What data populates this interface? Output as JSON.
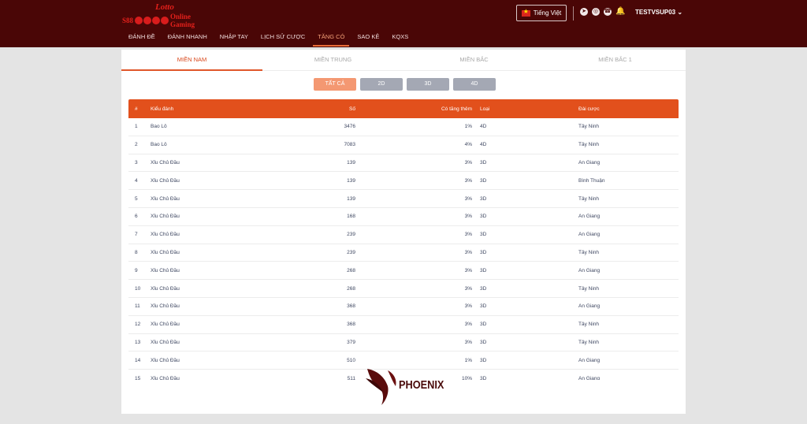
{
  "header": {
    "logo": {
      "top": "Lotto",
      "left": "S88",
      "right": "Online Gaming"
    },
    "language": "Tiếng Việt",
    "icons": [
      "telegram-icon",
      "messenger-icon",
      "whatsapp-icon",
      "bell-icon"
    ],
    "username": "TESTVSUP03"
  },
  "nav": [
    "ĐÁNH ĐỀ",
    "ĐÁNH NHANH",
    "NHẬP TAY",
    "LỊCH SỬ CƯỢC",
    "TĂNG CÓ",
    "SAO KÊ",
    "KQXS"
  ],
  "nav_active": "TĂNG CÓ",
  "region_tabs": [
    "MIỀN NAM",
    "MIỀN TRUNG",
    "MIỀN BẮC",
    "MIỀN BẮC 1"
  ],
  "filters": [
    "TẤT CẢ",
    "2D",
    "3D",
    "4D"
  ],
  "table": {
    "columns": [
      "#",
      "Kiểu đánh",
      "Số",
      "Có tăng thêm",
      "Loại",
      "Đài cược"
    ],
    "rows": [
      [
        "1",
        "Bao Lô",
        "3476",
        "1%",
        "4D",
        "Tây Ninh"
      ],
      [
        "2",
        "Bao Lô",
        "7083",
        "4%",
        "4D",
        "Tây Ninh"
      ],
      [
        "3",
        "Xỉu Chủ Đầu",
        "139",
        "3%",
        "3D",
        "An Giang"
      ],
      [
        "4",
        "Xỉu Chủ Đầu",
        "139",
        "3%",
        "3D",
        "Bình Thuận"
      ],
      [
        "5",
        "Xỉu Chủ Đầu",
        "139",
        "3%",
        "3D",
        "Tây Ninh"
      ],
      [
        "6",
        "Xỉu Chủ Đầu",
        "168",
        "3%",
        "3D",
        "An Giang"
      ],
      [
        "7",
        "Xỉu Chủ Đầu",
        "239",
        "3%",
        "3D",
        "An Giang"
      ],
      [
        "8",
        "Xỉu Chủ Đầu",
        "239",
        "3%",
        "3D",
        "Tây Ninh"
      ],
      [
        "9",
        "Xỉu Chủ Đầu",
        "268",
        "3%",
        "3D",
        "An Giang"
      ],
      [
        "10",
        "Xỉu Chủ Đầu",
        "268",
        "3%",
        "3D",
        "Tây Ninh"
      ],
      [
        "11",
        "Xỉu Chủ Đầu",
        "368",
        "3%",
        "3D",
        "An Giang"
      ],
      [
        "12",
        "Xỉu Chủ Đầu",
        "368",
        "3%",
        "3D",
        "Tây Ninh"
      ],
      [
        "13",
        "Xỉu Chủ Đầu",
        "379",
        "3%",
        "3D",
        "Tây Ninh"
      ],
      [
        "14",
        "Xỉu Chủ Đầu",
        "510",
        "1%",
        "3D",
        "An Giang"
      ],
      [
        "15",
        "Xỉu Chủ Đầu",
        "511",
        "10%",
        "3D",
        "An Giang"
      ]
    ]
  },
  "watermark": "PHOENIX",
  "colors": {
    "header_bg": "#4a0606",
    "accent": "#e2501c",
    "active_tab": "#d9481c"
  }
}
